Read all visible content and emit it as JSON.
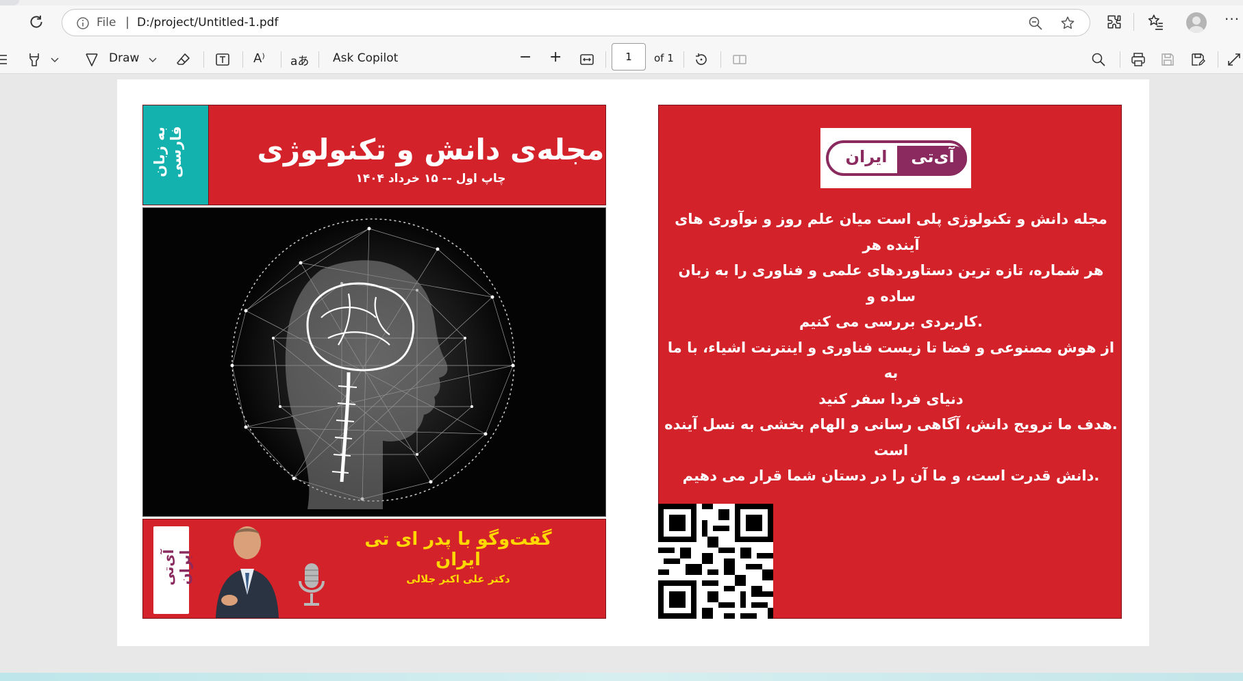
{
  "browser": {
    "url_scheme": "File",
    "url_separator": "|",
    "url": "D:/project/Untitled-1.pdf",
    "more_label": "···"
  },
  "pdf_toolbar": {
    "draw_label": "Draw",
    "read_aloud_glyph": "A⁾",
    "translate_glyph": "aあ",
    "copilot_label": "Ask Copilot",
    "zoom_out_glyph": "−",
    "zoom_in_glyph": "+",
    "page_value": "1",
    "page_total": "of 1"
  },
  "document": {
    "left_page": {
      "vertical_band_text": "به زبان فارسی",
      "title": "مجله‌ی دانش و تکنولوژی",
      "subtitle": "چاپ اول -- ۱۵ خرداد ۱۴۰۴",
      "interview_title": "گفت‌وگو با پدر ای تی ایران",
      "interview_subtitle": "دکتر علی اکبر جلالی",
      "footer_logo_text": "آی‌تی ایران"
    },
    "right_page": {
      "logo_text_colored": "آی‌تی",
      "logo_text_plain": "ایران",
      "description_lines": [
        "مجله دانش و تکنولوژی پلی است میان علم روز و نوآوری های آینده هر",
        "هر شماره، تازه ترین دستاوردهای علمی و فناوری را به زبان ساده و",
        ".کاربردی بررسی می کنیم",
        "از هوش مصنوعی و فضا تا زیست فناوری و اینترنت اشیاء، با ما به",
        "دنیای فردا سفر کنید",
        ".هدف ما ترویج دانش، آگاهی رسانی و الهام بخشی به نسل آینده است",
        ".دانش قدرت است، و ما آن را در دستان شما قرار می دهیم"
      ]
    }
  },
  "colors": {
    "cover_red": "#d4222a",
    "band_teal": "#14b2ae",
    "accent_yellow": "#ffd800",
    "brand_purple": "#8a2a5e"
  }
}
